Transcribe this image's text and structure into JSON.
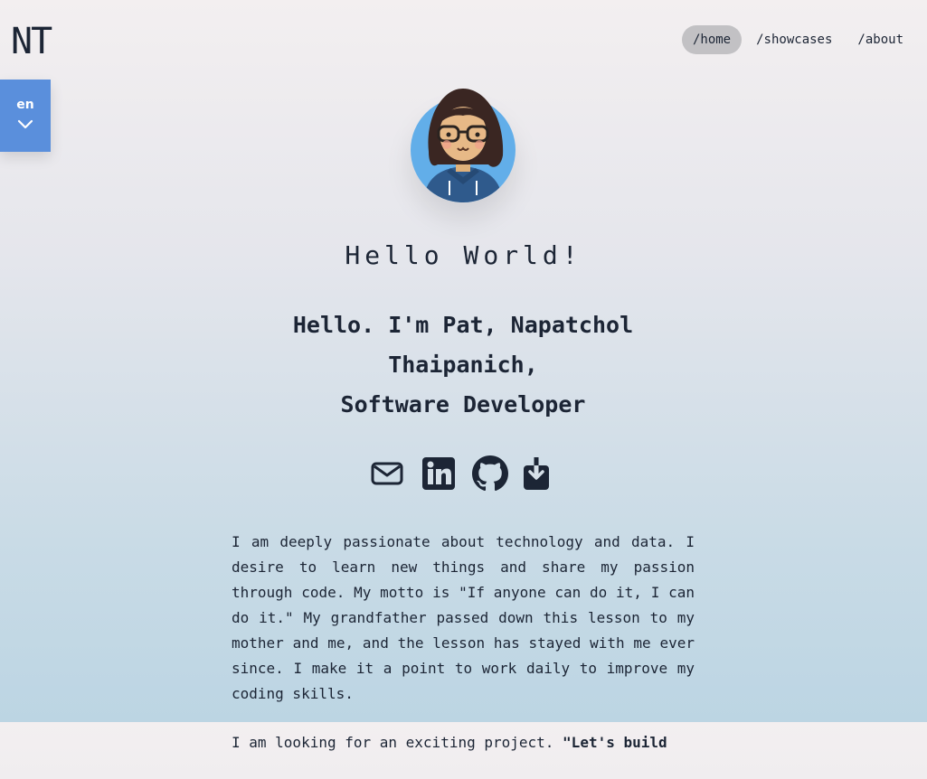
{
  "header": {
    "logo": "NT",
    "nav": [
      {
        "label": "/home",
        "active": true
      },
      {
        "label": "/showcases",
        "active": false
      },
      {
        "label": "/about",
        "active": false
      }
    ]
  },
  "language": {
    "current": "en",
    "icon": "chevron-down-icon",
    "color": "#5a8fdc"
  },
  "avatar": {
    "icon": "avatar-illustration"
  },
  "hero": {
    "greeting": "Hello World!",
    "intro_line1": "Hello. I'm Pat, Napatchol Thaipanich,",
    "intro_line2": "Software Developer"
  },
  "socials": [
    {
      "icon": "mail-icon"
    },
    {
      "icon": "linkedin-icon"
    },
    {
      "icon": "github-icon"
    },
    {
      "icon": "download-icon"
    }
  ],
  "bio": {
    "p1": "I am deeply passionate about technology and data. I desire to learn new things and share my passion through code. My motto is \"If anyone can do it, I can do it.\" My grandfather passed down this lesson to my mother and me, and the lesson has stayed with me ever since. I make it a point to work daily to improve my coding skills.",
    "p2_start": "I am looking for an exciting project. ",
    "p2_bold": "\"Let's build"
  }
}
